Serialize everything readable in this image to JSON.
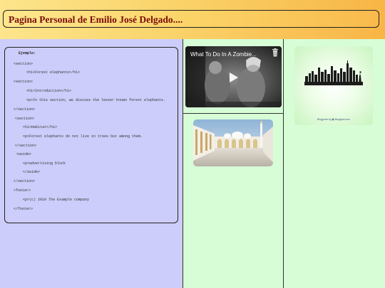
{
  "header": {
    "title": "Pagina Personal de Emilio José Delgado...."
  },
  "code": {
    "heading": "Ejemplo:",
    "lines": [
      "<section>",
      "<h1>Forest elephants</h1>",
      "<section>",
      "<h1>Introduction</h1>",
      "<p>In this section, we discuss the lesser known forest elephants.",
      "</section>",
      "<section>",
      "<h1>Habitat</h1>",
      "<p>Forest elephants do not live in trees but among them.",
      "</section>",
      "<aside>",
      "<p>advertising block",
      "</aside>",
      "</section>",
      "<footer>",
      "<p>(c) 2010 The Example company",
      "</footer>"
    ]
  },
  "video": {
    "title": "What To Do In A Zombie..."
  },
  "skyline": {
    "caption": "Blogprofe by ▦ Blogspot.com"
  },
  "colors": {
    "left_column": "#cdcdfb",
    "middle_column": "#d7fdd7",
    "right_column": "#d7fdd7",
    "title_text": "#7a0a0a"
  }
}
